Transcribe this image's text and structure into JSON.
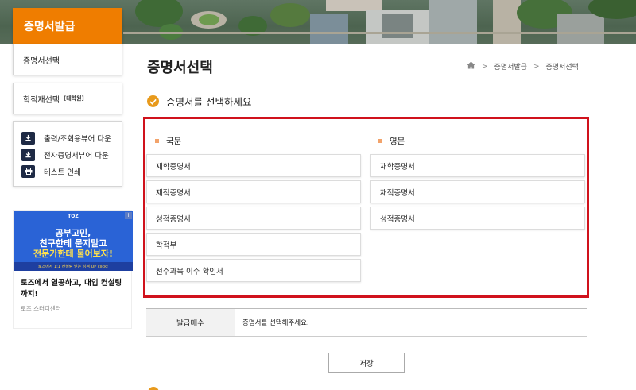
{
  "sidebar": {
    "header": "증명서발급",
    "menu": [
      {
        "label": "증명서선택"
      },
      {
        "label": "학적재선택",
        "tag": "[대학원]"
      }
    ],
    "tools": [
      {
        "icon": "download-icon",
        "label": "출력/조회용뷰어 다운"
      },
      {
        "icon": "download-icon",
        "label": "전자증명서뷰어 다운"
      },
      {
        "icon": "printer-icon",
        "label": "테스트 인쇄"
      }
    ]
  },
  "ad": {
    "brand": "TOZ",
    "headline": [
      "공부고민,",
      "친구한테 묻지말고",
      "전문가한테 물어보자!"
    ],
    "strip": "토즈에서 1:1 컨설팅 받는 성적 UP click!",
    "info_badge": "i",
    "text": "토즈에서 열공하고, 대입 컨설팅까지!",
    "sponsor": "토즈 스터디센터"
  },
  "main": {
    "title": "증명서선택",
    "breadcrumb": {
      "home_icon": "home-icon",
      "items": [
        "증명서발급",
        "증명서선택"
      ]
    },
    "instruction": "증명서를 선택하세요",
    "korean": {
      "title": "국문",
      "items": [
        "재학증명서",
        "재적증명서",
        "성적증명서",
        "학적부",
        "선수과목 이수 확인서"
      ]
    },
    "english": {
      "title": "영문",
      "items": [
        "재학증명서",
        "재적증명서",
        "성적증명서"
      ]
    },
    "issue": {
      "label": "발급매수",
      "value": "증명서를 선택해주세요."
    },
    "save_label": "저장"
  },
  "colors": {
    "accent_orange": "#ef7d00",
    "highlight_red": "#d0121c",
    "icon_navy": "#1e2a45",
    "ad_blue": "#2a63d6"
  }
}
